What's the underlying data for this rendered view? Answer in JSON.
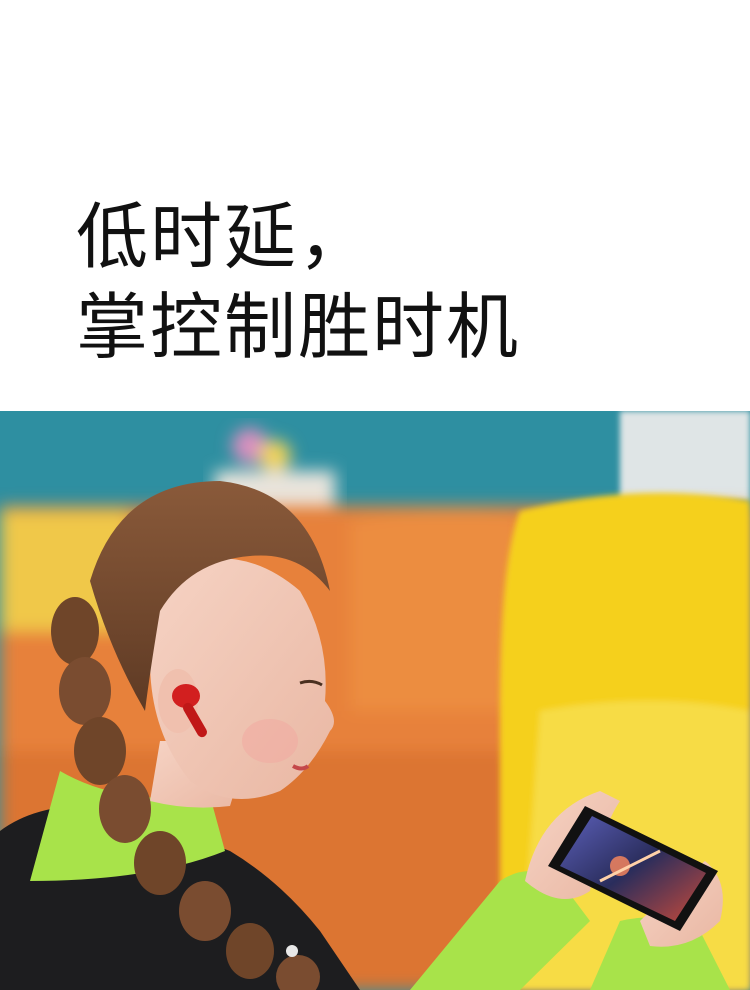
{
  "headline": {
    "line1": "低时延，",
    "line2": "掌控制胜时机"
  },
  "photo": {
    "subject": "girl-with-red-earbud-playing-mobile-game",
    "colors": {
      "wall": "#2e8fa1",
      "sofa_orange": "#e7813a",
      "sofa_yellow": "#f5d01f",
      "shirt_green": "#a8e34a",
      "hair": "#7a4c30",
      "earbud": "#d21f1f",
      "phone_screen": "#3b3f7a"
    }
  }
}
